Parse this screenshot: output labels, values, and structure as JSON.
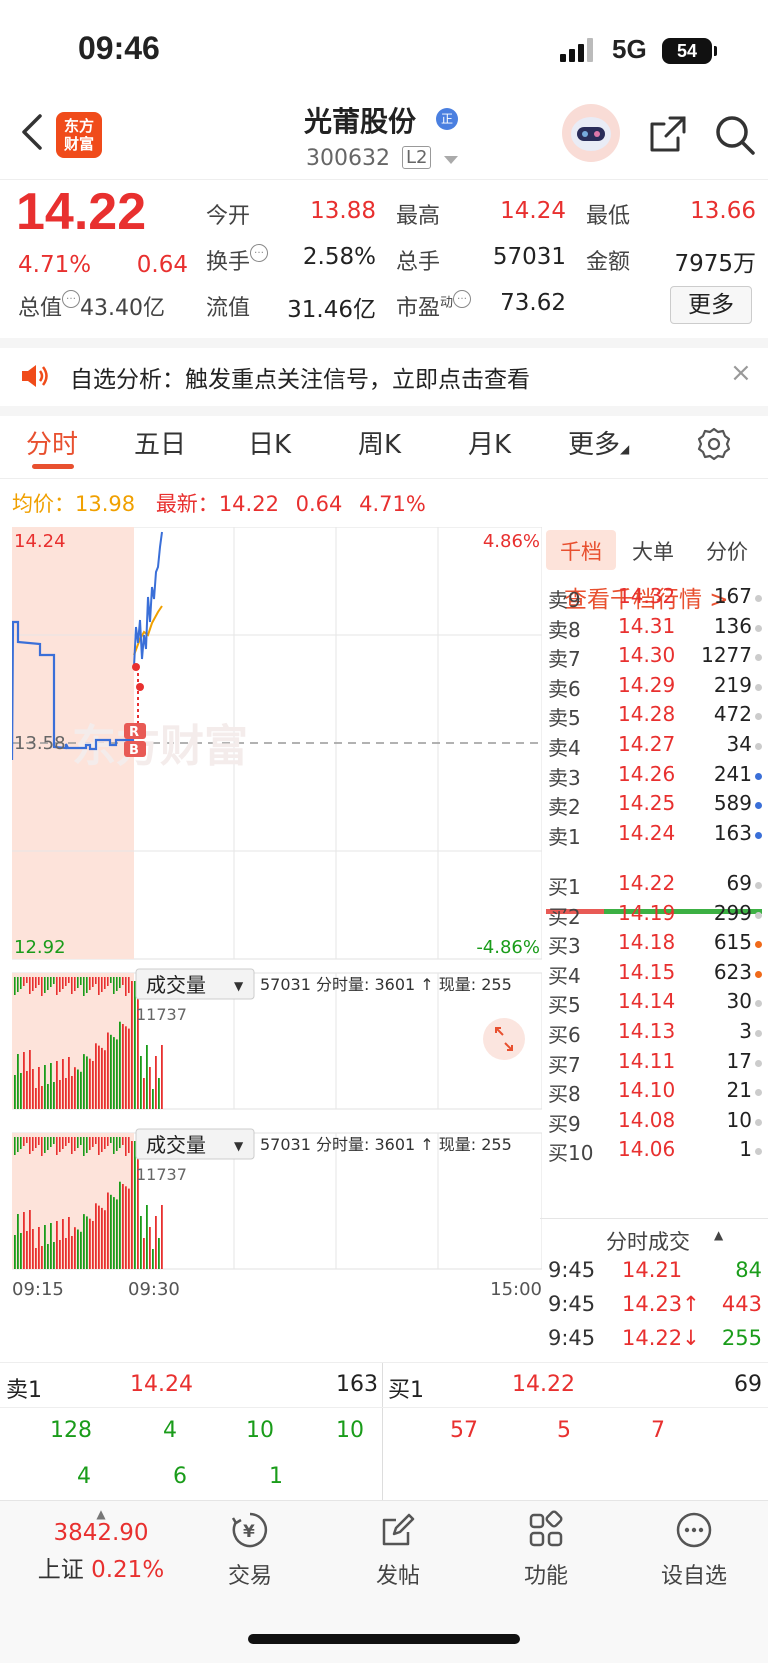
{
  "status": {
    "time": "09:46",
    "network": "5G",
    "battery": "54"
  },
  "header": {
    "logo_line1": "东方",
    "logo_line2": "财富",
    "stock_name": "光莆股份",
    "badge": "正",
    "code": "300632",
    "level": "L2"
  },
  "quote": {
    "price": "14.22",
    "change_pct": "4.71%",
    "change": "0.64",
    "open_label": "今开",
    "open": "13.88",
    "high_label": "最高",
    "high": "14.24",
    "low_label": "最低",
    "low": "13.66",
    "turnover_label": "换手",
    "turnover": "2.58%",
    "volume_label": "总手",
    "volume": "57031",
    "amount_label": "金额",
    "amount": "7975万",
    "mcap_label": "总值",
    "mcap": "43.40亿",
    "float_label": "流值",
    "float": "31.46亿",
    "pe_label": "市盈",
    "pe_sup": "动",
    "pe": "73.62",
    "more_button": "更多"
  },
  "notice": {
    "text": "自选分析：触发重点关注信号，立即点击查看",
    "close": "×"
  },
  "tabs": [
    "分时",
    "五日",
    "日K",
    "周K",
    "月K",
    "更多"
  ],
  "priceline": {
    "avg_label": "均价：",
    "avg": "13.98",
    "last_label": "最新：",
    "last": "14.22",
    "chg": "0.64",
    "pct": "4.71%"
  },
  "chart": {
    "y_top": "14.24",
    "y_mid": "13.58",
    "y_bottom": "12.92",
    "pct_top": "4.86%",
    "pct_bottom": "-4.86%",
    "watermark": "东方财富",
    "vol_selector": "成交量",
    "vol_info_1": "57031 分时量: 3601 ↑ 现量: 255",
    "vol_max": "11737",
    "vol_selector_2": "成交量",
    "vol_info_2": "57031 分时量: 3601 ↑ 现量: 255",
    "vol_max_2": "11737",
    "time_start": "09:15",
    "time_open": "09:30",
    "time_end": "15:00",
    "marker_r": "R",
    "marker_b": "B"
  },
  "book": {
    "tabs": [
      "千档",
      "大单",
      "分价"
    ],
    "link": "查看千档行情 >",
    "asks": [
      {
        "label": "卖9",
        "price": "14.32",
        "vol": "167",
        "dot": "#cccccc"
      },
      {
        "label": "卖8",
        "price": "14.31",
        "vol": "136",
        "dot": "#cccccc"
      },
      {
        "label": "卖7",
        "price": "14.30",
        "vol": "1277",
        "dot": "#cccccc"
      },
      {
        "label": "卖6",
        "price": "14.29",
        "vol": "219",
        "dot": "#cccccc"
      },
      {
        "label": "卖5",
        "price": "14.28",
        "vol": "472",
        "dot": "#cccccc"
      },
      {
        "label": "卖4",
        "price": "14.27",
        "vol": "34",
        "dot": "#cccccc"
      },
      {
        "label": "卖3",
        "price": "14.26",
        "vol": "241",
        "dot": "#3a6fd8"
      },
      {
        "label": "卖2",
        "price": "14.25",
        "vol": "589",
        "dot": "#3a6fd8"
      },
      {
        "label": "卖1",
        "price": "14.24",
        "vol": "163",
        "dot": "#3a6fd8"
      }
    ],
    "bids": [
      {
        "label": "买1",
        "price": "14.22",
        "vol": "69",
        "dot": "#cccccc"
      },
      {
        "label": "买2",
        "price": "14.19",
        "vol": "299",
        "dot": "#cccccc"
      },
      {
        "label": "买3",
        "price": "14.18",
        "vol": "615",
        "dot": "#f06a1a"
      },
      {
        "label": "买4",
        "price": "14.15",
        "vol": "623",
        "dot": "#f06a1a"
      },
      {
        "label": "买5",
        "price": "14.14",
        "vol": "30",
        "dot": "#cccccc"
      },
      {
        "label": "买6",
        "price": "14.13",
        "vol": "3",
        "dot": "#cccccc"
      },
      {
        "label": "买7",
        "price": "14.11",
        "vol": "17",
        "dot": "#cccccc"
      },
      {
        "label": "买8",
        "price": "14.10",
        "vol": "21",
        "dot": "#cccccc"
      },
      {
        "label": "买9",
        "price": "14.08",
        "vol": "10",
        "dot": "#cccccc"
      },
      {
        "label": "买10",
        "price": "14.06",
        "vol": "1",
        "dot": "#cccccc"
      }
    ],
    "ticks_title": "分时成交",
    "ticks": [
      {
        "time": "9:45",
        "price": "14.21",
        "vol": "84",
        "color": "#1a9c1a"
      },
      {
        "time": "9:45",
        "price": "14.23↑",
        "vol": "443",
        "color": "#e8302f"
      },
      {
        "time": "9:45",
        "price": "14.22↓",
        "vol": "255",
        "color": "#1a9c1a"
      }
    ]
  },
  "level1": {
    "ask_label": "卖1",
    "ask_price": "14.24",
    "ask_vol": "163",
    "bid_label": "买1",
    "bid_price": "14.22",
    "bid_vol": "69",
    "ask_queue_row1": [
      "128",
      "4",
      "10",
      "10"
    ],
    "ask_queue_row2": [
      "4",
      "6",
      "1"
    ],
    "bid_queue_row1": [
      "57",
      "5",
      "7"
    ]
  },
  "bottom_nav": {
    "index_value": "3842.90",
    "index_name": "上证",
    "index_pct": "0.21%",
    "items": [
      "交易",
      "发帖",
      "功能",
      "设自选"
    ]
  },
  "colors": {
    "up": "#e8302f",
    "down": "#1a9c1a",
    "accent": "#e8502f",
    "avg": "#f0a000"
  }
}
